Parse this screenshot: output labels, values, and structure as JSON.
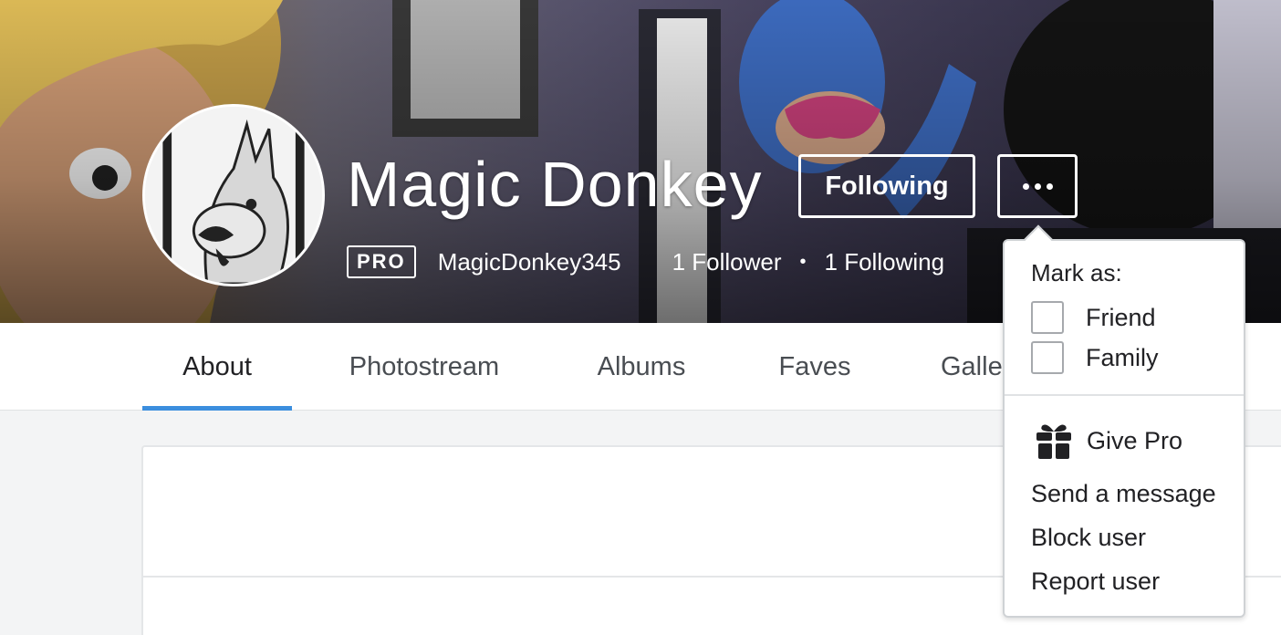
{
  "profile": {
    "name": "Magic Donkey",
    "badge": "PRO",
    "username": "MagicDonkey345",
    "followers": "1 Follower",
    "separator": "•",
    "following": "1 Following"
  },
  "actions": {
    "following_label": "Following",
    "more_icon": "ellipsis-icon"
  },
  "tabs": [
    {
      "label": "About",
      "active": true
    },
    {
      "label": "Photostream",
      "active": false
    },
    {
      "label": "Albums",
      "active": false
    },
    {
      "label": "Faves",
      "active": false
    },
    {
      "label": "Galleries",
      "active": false
    }
  ],
  "menu": {
    "title": "Mark as:",
    "checkboxes": [
      {
        "label": "Friend",
        "checked": false
      },
      {
        "label": "Family",
        "checked": false
      }
    ],
    "items": [
      {
        "label": "Give Pro",
        "icon": "gift-icon"
      },
      {
        "label": "Send a message"
      },
      {
        "label": "Block user"
      },
      {
        "label": "Report user"
      }
    ]
  },
  "colors": {
    "active_tab_underline": "#3b8ede",
    "text_dark": "#212124"
  }
}
